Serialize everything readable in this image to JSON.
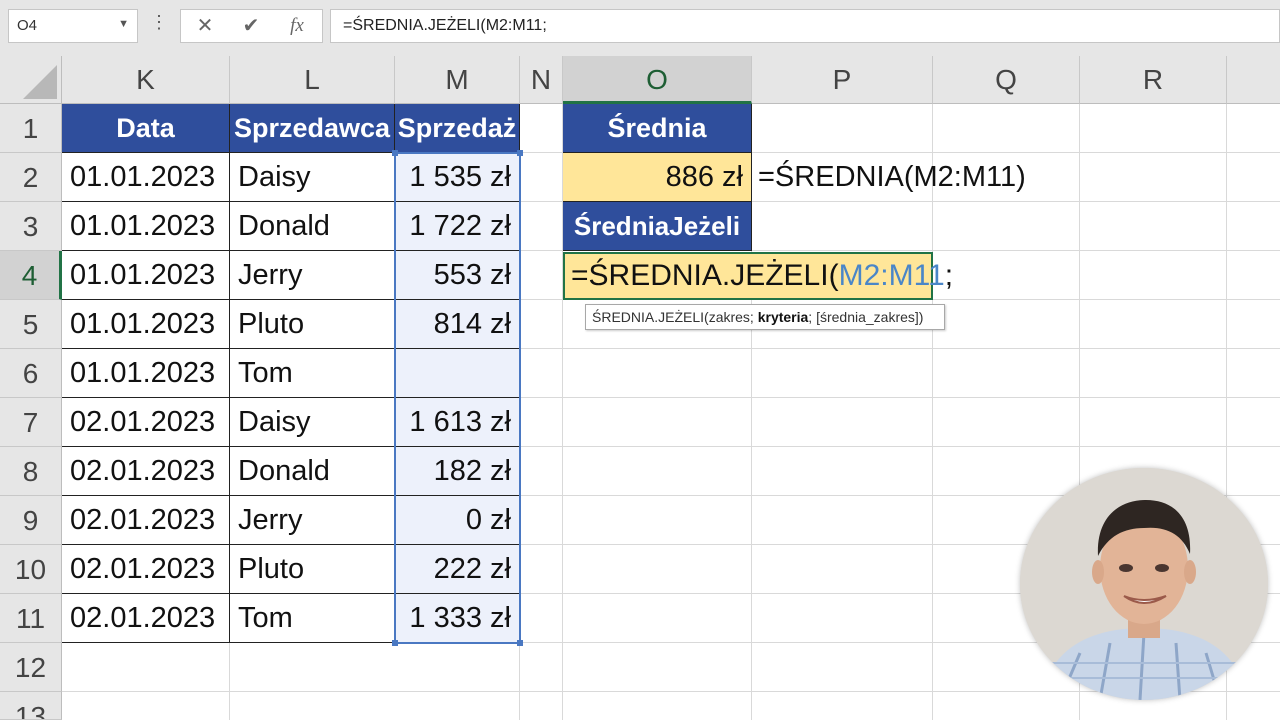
{
  "formula_bar": {
    "name_box": "O4",
    "cancel_icon": "✕",
    "enter_icon": "✔",
    "fx_icon": "fx",
    "formula": "=ŚREDNIA.JEŻELI(M2:M11;"
  },
  "columns": [
    "K",
    "L",
    "M",
    "N",
    "O",
    "P",
    "Q",
    "R"
  ],
  "rows": [
    "1",
    "2",
    "3",
    "4",
    "5",
    "6",
    "7",
    "8",
    "9",
    "10",
    "11",
    "12",
    "13"
  ],
  "table": {
    "headers": {
      "date": "Data",
      "seller": "Sprzedawca",
      "sales": "Sprzedaż"
    },
    "rows": [
      {
        "date": "01.01.2023",
        "seller": "Daisy",
        "sales": "1 535 zł"
      },
      {
        "date": "01.01.2023",
        "seller": "Donald",
        "sales": "1 722 zł"
      },
      {
        "date": "01.01.2023",
        "seller": "Jerry",
        "sales": "553 zł"
      },
      {
        "date": "01.01.2023",
        "seller": "Pluto",
        "sales": "814 zł"
      },
      {
        "date": "01.01.2023",
        "seller": "Tom",
        "sales": ""
      },
      {
        "date": "02.01.2023",
        "seller": "Daisy",
        "sales": "1 613 zł"
      },
      {
        "date": "02.01.2023",
        "seller": "Donald",
        "sales": "182 zł"
      },
      {
        "date": "02.01.2023",
        "seller": "Jerry",
        "sales": "0 zł"
      },
      {
        "date": "02.01.2023",
        "seller": "Pluto",
        "sales": "222 zł"
      },
      {
        "date": "02.01.2023",
        "seller": "Tom",
        "sales": "1 333 zł"
      }
    ]
  },
  "summary": {
    "avg_header": "Średnia",
    "avg_value": "886 zł",
    "avg_formula": "=ŚREDNIA(M2:M11)",
    "avgif_header": "ŚredniaJeżeli",
    "edit_prefix": "=ŚREDNIA.JEŻELI(",
    "edit_ref": "M2:M11",
    "edit_suffix": ";"
  },
  "tooltip": {
    "func": "ŚREDNIA.JEŻELI(zakres; ",
    "bold_arg": "kryteria",
    "rest": "; [średnia_zakres])"
  },
  "colors": {
    "header_fill": "#2f4e9c",
    "gold_fill": "#ffe699",
    "selection": "#217346",
    "range_border": "#4a78c2"
  }
}
